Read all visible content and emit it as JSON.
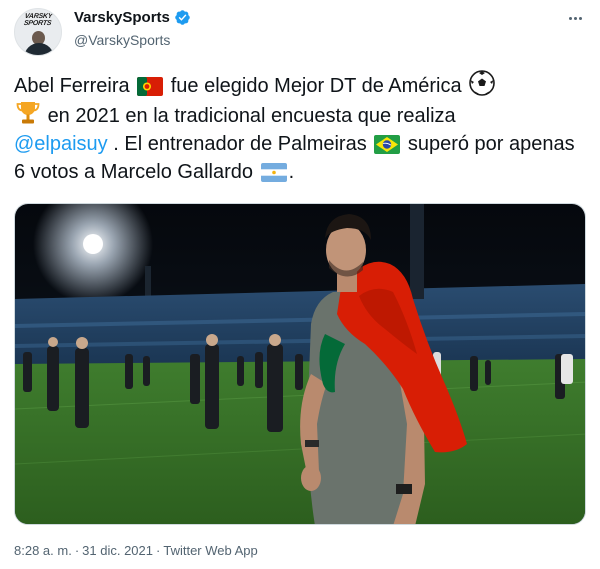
{
  "author": {
    "display_name": "VarskySports",
    "handle": "@VarskySports",
    "avatar_logo_text": "VARSKY SPORTS",
    "verified": true
  },
  "tweet": {
    "text_1": "Abel Ferreira",
    "text_2": "fue elegido Mejor DT de América",
    "text_3": "en 2021 en la tradicional encuesta que realiza",
    "mention": "@elpaisuy",
    "text_4": ". El entrenador de Palmeiras",
    "text_5": "superó por apenas 6 votos a Marcelo Gallardo",
    "text_6": ".",
    "emojis": [
      "flag-portugal-icon",
      "soccer-ball-icon",
      "trophy-icon",
      "flag-brazil-icon",
      "flag-argentina-icon"
    ]
  },
  "media": {
    "description_icon": "photo",
    "colors": {
      "flag_red": "#d81e05",
      "flag_green": "#046a38",
      "pitch": "#3e7f2b"
    }
  },
  "footer": {
    "time": "8:28 a. m.",
    "date": "31 dic. 2021",
    "source": "Twitter Web App",
    "separator": "·"
  },
  "colors": {
    "link": "#1d9bf0",
    "secondary": "#536471",
    "text": "#0f1419"
  }
}
